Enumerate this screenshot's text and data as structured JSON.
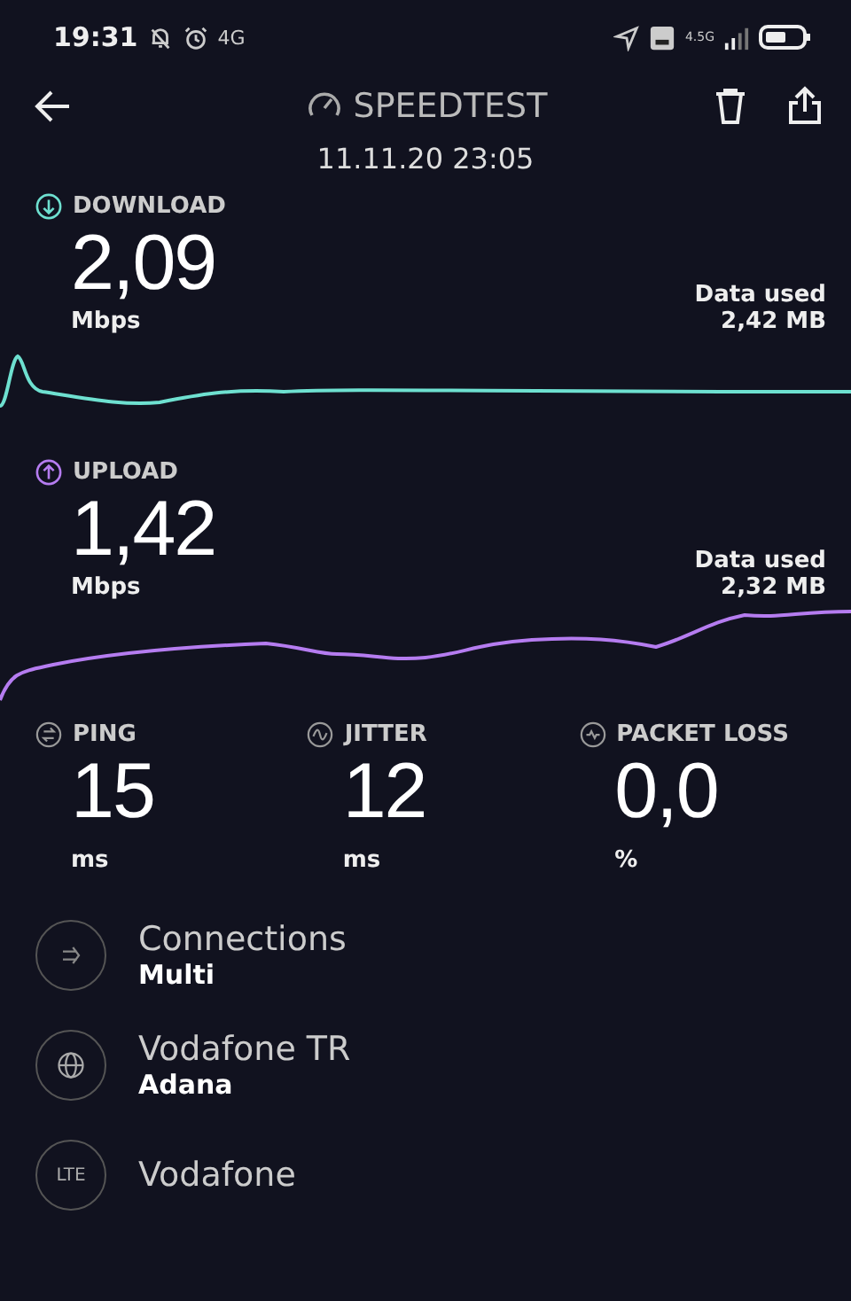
{
  "status_bar": {
    "time": "19:31",
    "network": "4G",
    "signal_label": "4.5G"
  },
  "header": {
    "title": "SPEEDTEST",
    "date": "11.11.20 23:05"
  },
  "results": [
    {
      "kind": "download",
      "label": "DOWNLOAD",
      "value": "2,09",
      "unit": "Mbps",
      "data_label": "Data used",
      "data_value": "2,42 MB",
      "color": "#6ee0d0"
    },
    {
      "kind": "upload",
      "label": "UPLOAD",
      "value": "1,42",
      "unit": "Mbps",
      "data_label": "Data used",
      "data_value": "2,32 MB",
      "color": "#b57cf0"
    }
  ],
  "metrics": [
    {
      "kind": "ping",
      "label": "PING",
      "value": "15",
      "unit": "ms"
    },
    {
      "kind": "jitter",
      "label": "JITTER",
      "value": "12",
      "unit": "ms"
    },
    {
      "kind": "loss",
      "label": "PACKET LOSS",
      "value": "0,0",
      "unit": "%"
    }
  ],
  "details": [
    {
      "kind": "connections",
      "title": "Connections",
      "subtitle": "Multi"
    },
    {
      "kind": "server",
      "title": "Vodafone TR",
      "subtitle": "Adana"
    },
    {
      "kind": "provider",
      "icon_text": "LTE",
      "title": "Vodafone"
    }
  ]
}
